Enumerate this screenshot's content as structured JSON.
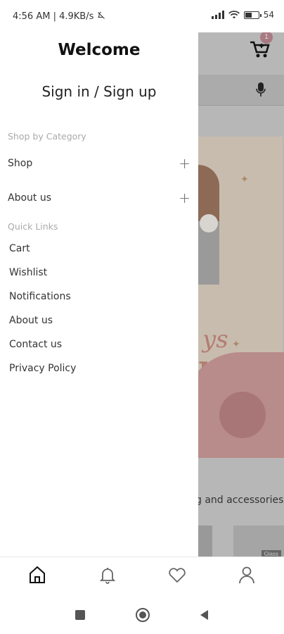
{
  "status_bar": {
    "left_text": "4:56 AM | 4.9KB/s",
    "battery": "54",
    "battery_level": 0.54
  },
  "drawer": {
    "welcome": "Welcome",
    "sign_in": "Sign in / Sign up",
    "shop_by_category_title": "Shop by Category",
    "categories": [
      {
        "label": "Shop",
        "icon": "plus-icon"
      },
      {
        "label": "About us",
        "icon": "plus-icon"
      }
    ],
    "quick_links_title": "Quick Links",
    "quick_links": [
      "Cart",
      "Wishlist",
      "Notifications",
      "About us",
      "Contact us",
      "Privacy Policy"
    ]
  },
  "background_app": {
    "cart_badge": "1",
    "banner_script": "ys",
    "banner_word": "ne",
    "section_text": "g and accessories",
    "thumb_tag": "Glass"
  },
  "bottom_nav": {
    "items": [
      {
        "name": "home-icon"
      },
      {
        "name": "bell-icon"
      },
      {
        "name": "heart-icon"
      },
      {
        "name": "profile-icon"
      }
    ]
  },
  "colors": {
    "overlay_gray": "#b7b7b7",
    "text_dark": "#222222",
    "section_gray": "#aaaaaa"
  }
}
